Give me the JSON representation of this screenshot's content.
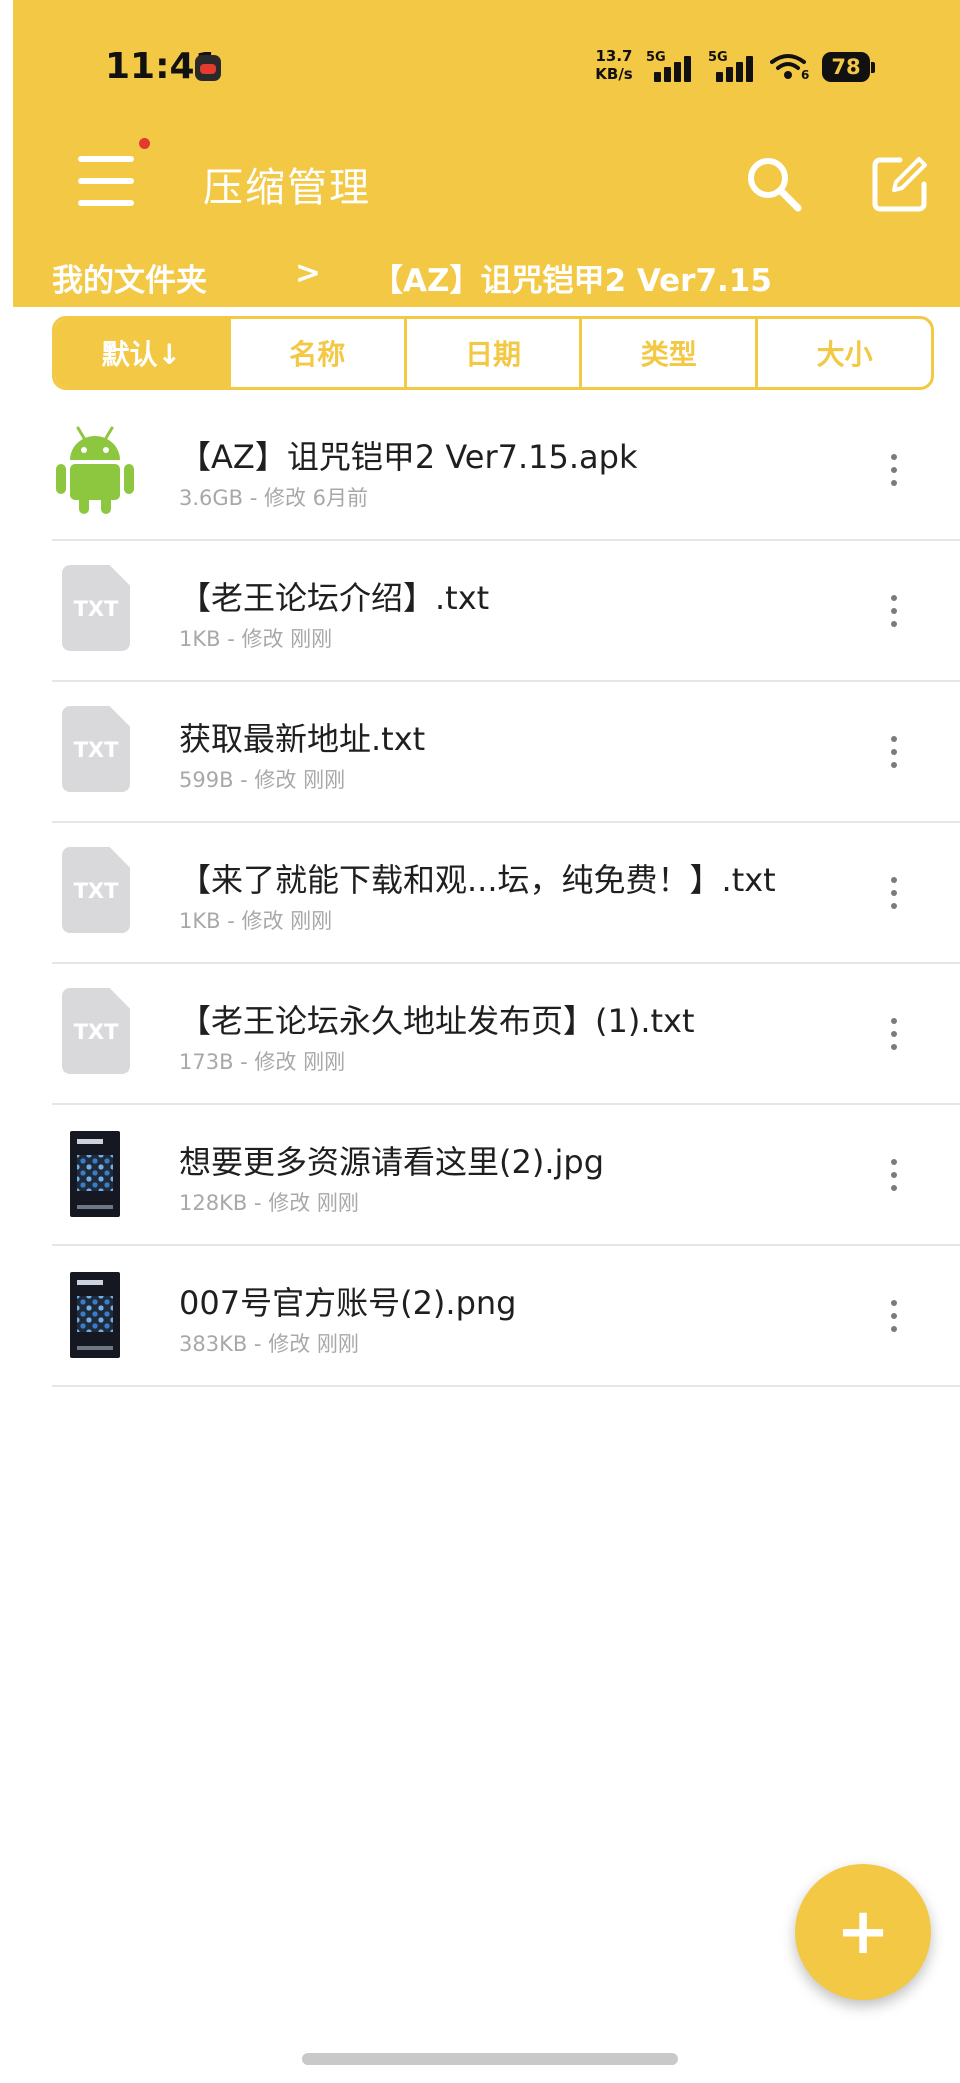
{
  "status_bar": {
    "time": "11:41",
    "net_speed_value": "13.7",
    "net_speed_unit": "KB/s",
    "sim1": "5G",
    "sim2": "5G",
    "wifi_sub": "6",
    "battery": "78"
  },
  "header": {
    "title": "压缩管理",
    "has_notification_dot": true
  },
  "breadcrumb": {
    "root": "我的文件夹",
    "separator": ">",
    "current": "【AZ】诅咒铠甲2 Ver7.15"
  },
  "sort_tabs": [
    {
      "label": "默认↓",
      "active": true
    },
    {
      "label": "名称",
      "active": false
    },
    {
      "label": "日期",
      "active": false
    },
    {
      "label": "类型",
      "active": false
    },
    {
      "label": "大小",
      "active": false
    }
  ],
  "files": [
    {
      "name": "【AZ】诅咒铠甲2 Ver7.15.apk",
      "meta": "3.6GB - 修改 6月前",
      "icon": "android-icon"
    },
    {
      "name": "【老王论坛介绍】.txt",
      "meta": "1KB - 修改 刚刚",
      "icon": "txt-file-icon"
    },
    {
      "name": "获取最新地址.txt",
      "meta": "599B - 修改 刚刚",
      "icon": "txt-file-icon"
    },
    {
      "name": "【来了就能下载和观...坛，纯免费！】.txt",
      "meta": "1KB - 修改 刚刚",
      "icon": "txt-file-icon"
    },
    {
      "name": "【老王论坛永久地址发布页】(1).txt",
      "meta": "173B - 修改 刚刚",
      "icon": "txt-file-icon"
    },
    {
      "name": "想要更多资源请看这里(2).jpg",
      "meta": "128KB - 修改 刚刚",
      "icon": "image-thumbnail"
    },
    {
      "name": "007号官方账号(2).png",
      "meta": "383KB - 修改 刚刚",
      "icon": "image-thumbnail"
    }
  ],
  "fab": {
    "label": "+"
  },
  "colors": {
    "accent": "#f3c844",
    "header_text": "#ffffff",
    "android_green": "#8dc63f",
    "meta_text": "#a8a8a8"
  }
}
